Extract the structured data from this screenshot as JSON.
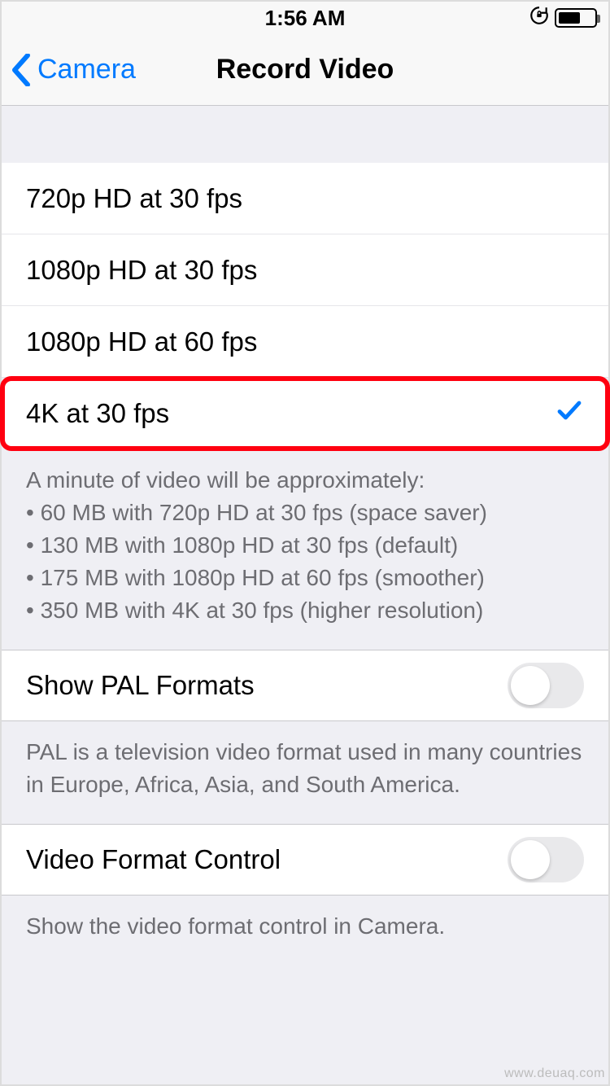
{
  "status": {
    "time": "1:56 AM"
  },
  "nav": {
    "back_label": "Camera",
    "title": "Record Video"
  },
  "options": [
    {
      "label": "720p HD at 30 fps",
      "selected": false
    },
    {
      "label": "1080p HD at 30 fps",
      "selected": false
    },
    {
      "label": "1080p HD at 60 fps",
      "selected": false
    },
    {
      "label": "4K at 30 fps",
      "selected": true,
      "highlighted": true
    }
  ],
  "size_footer": {
    "intro": "A minute of video will be approximately:",
    "lines": [
      "60 MB with 720p HD at 30 fps (space saver)",
      "130 MB with 1080p HD at 30 fps (default)",
      "175 MB with 1080p HD at 60 fps (smoother)",
      "350 MB with 4K at 30 fps (higher resolution)"
    ]
  },
  "pal": {
    "label": "Show PAL Formats",
    "enabled": false,
    "footer": "PAL is a television video format used in many countries in Europe, Africa, Asia, and South America."
  },
  "vfc": {
    "label": "Video Format Control",
    "enabled": false,
    "footer": "Show the video format control in Camera."
  },
  "watermark": "www.deuaq.com"
}
